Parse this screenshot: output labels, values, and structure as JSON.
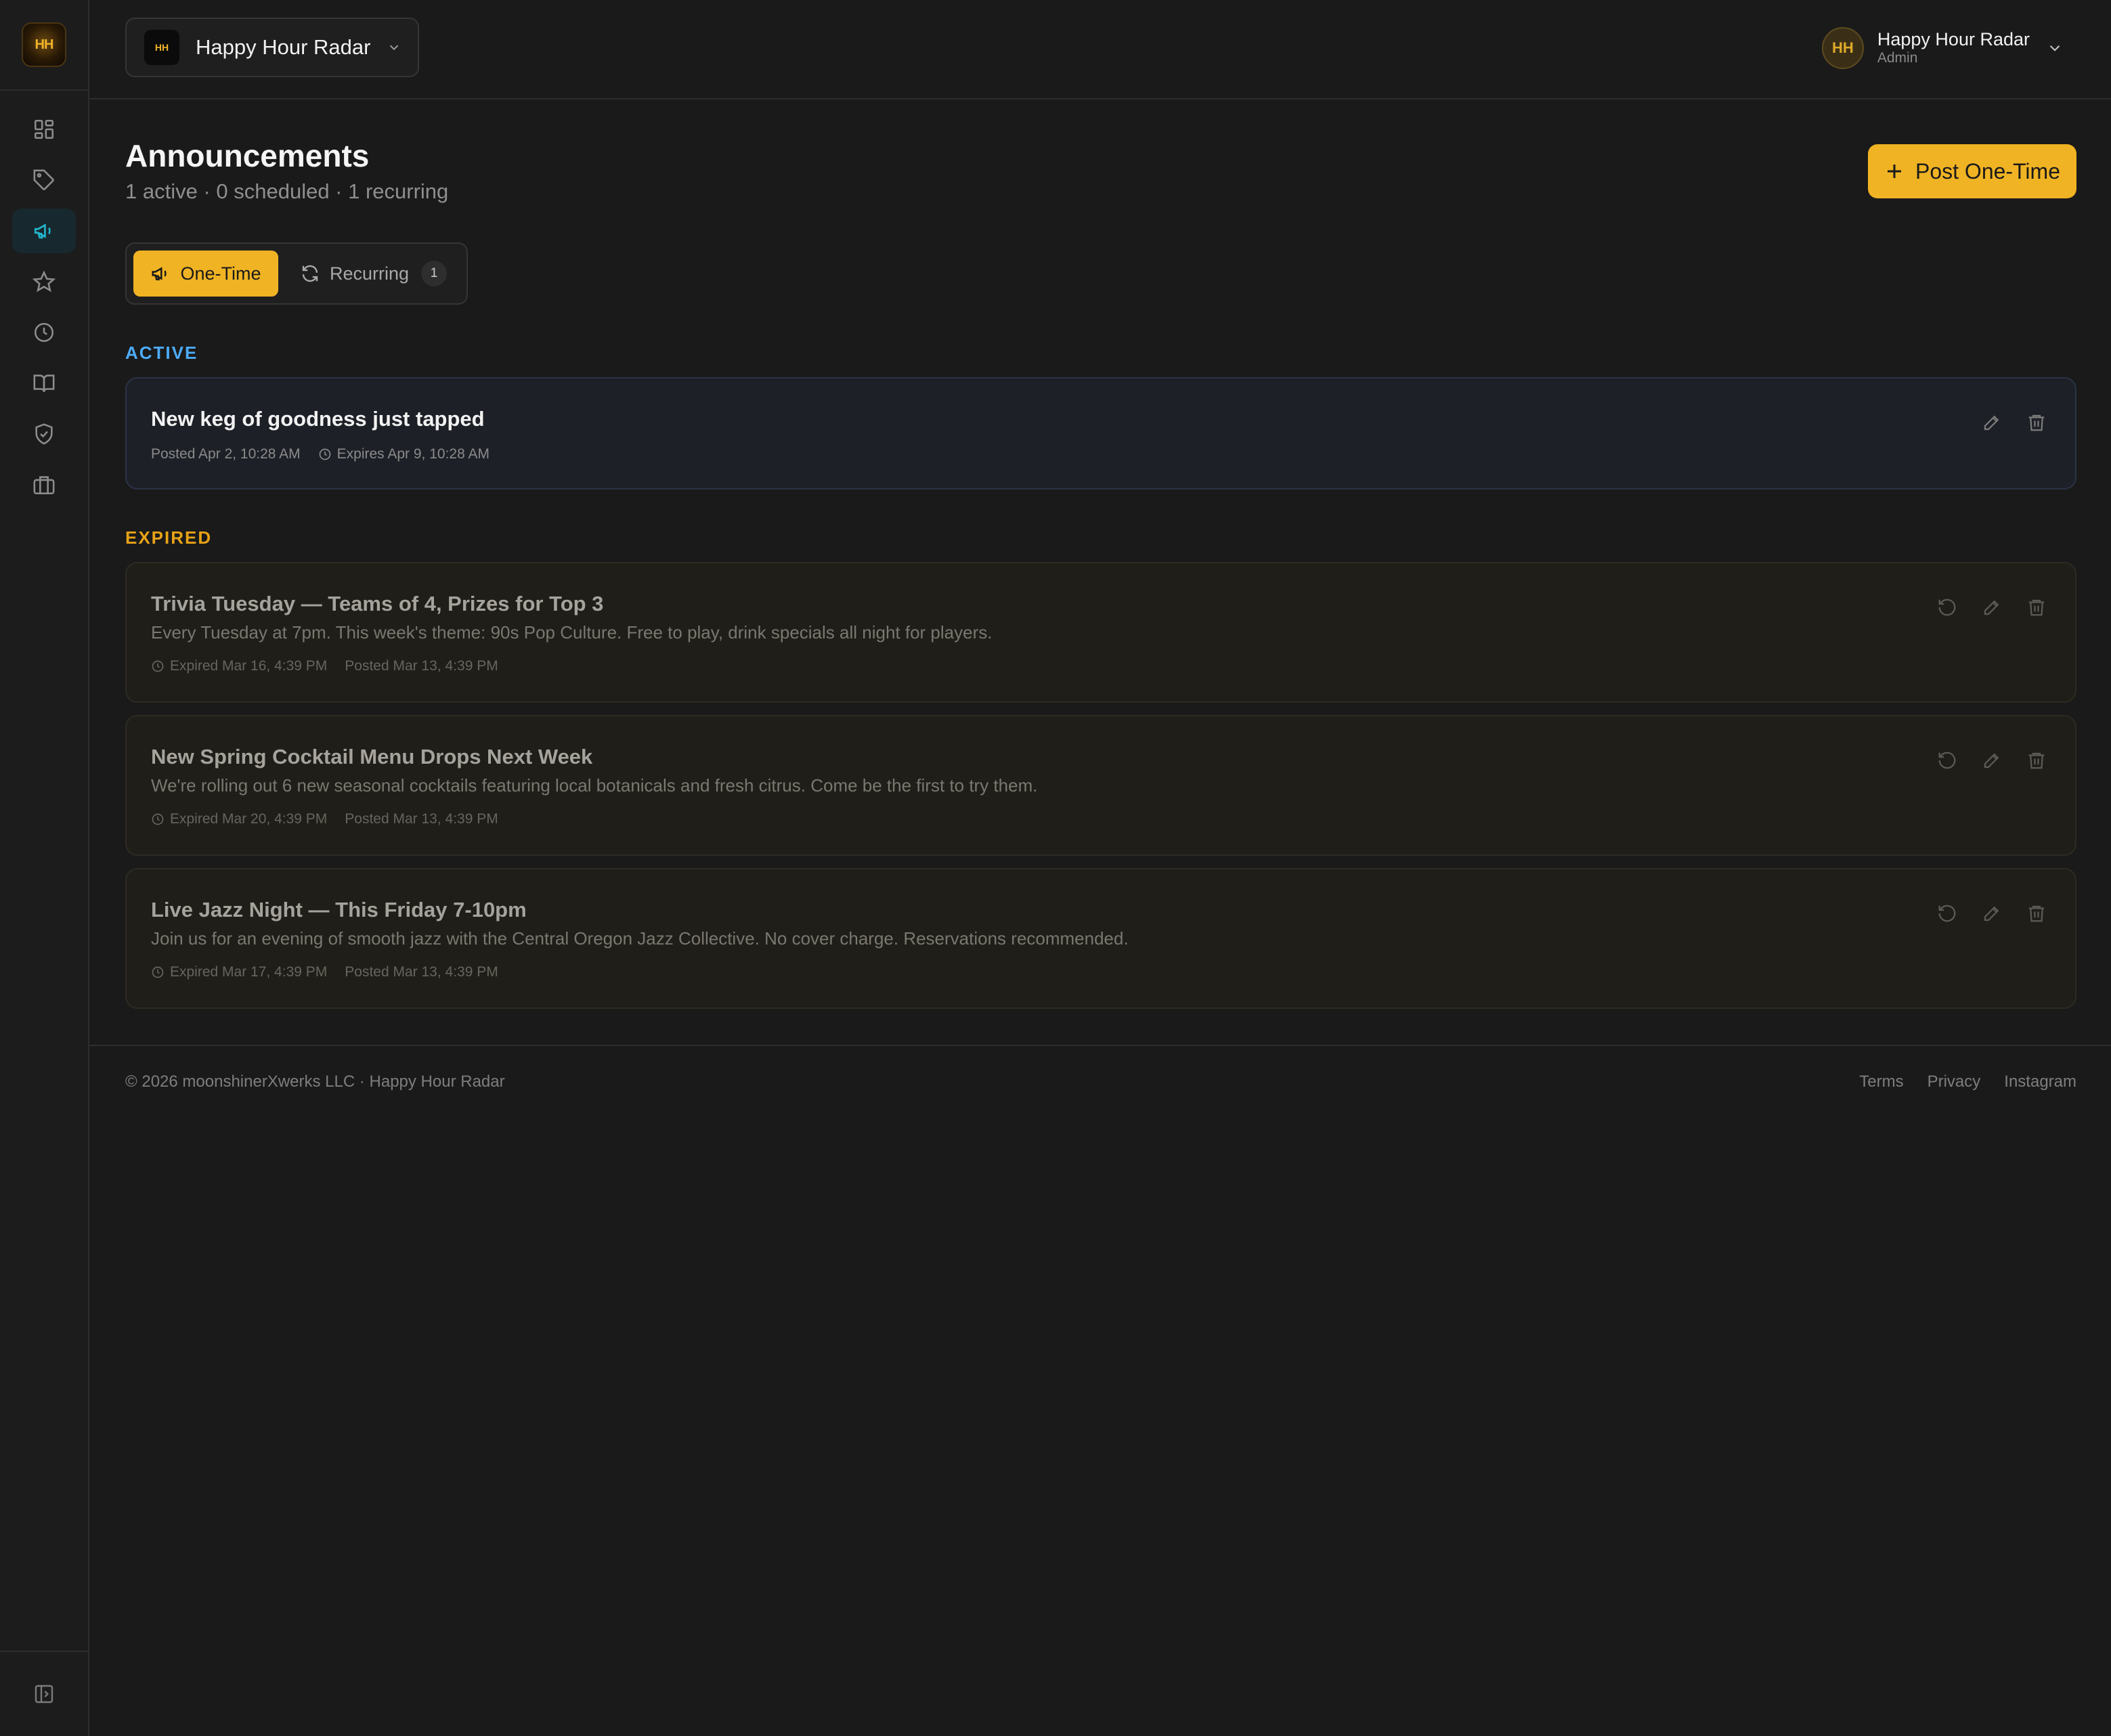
{
  "colors": {
    "accent": "#f0b323",
    "active_blue": "#4dabf7",
    "expired_amber": "#e8a317",
    "nav_active": "#22b8cf"
  },
  "sidebar": {
    "logo_text": "HH",
    "items": [
      {
        "icon": "dashboard-icon"
      },
      {
        "icon": "tag-icon"
      },
      {
        "icon": "megaphone-icon",
        "active": true
      },
      {
        "icon": "star-icon"
      },
      {
        "icon": "clock-icon"
      },
      {
        "icon": "book-icon"
      },
      {
        "icon": "shield-check-icon"
      },
      {
        "icon": "briefcase-icon"
      }
    ],
    "collapse_icon": "sidebar-collapse-icon"
  },
  "topbar": {
    "venue_logo_text": "HH",
    "venue_name": "Happy Hour Radar",
    "user": {
      "initials": "HH",
      "name": "Happy Hour Radar",
      "role": "Admin"
    }
  },
  "page": {
    "title": "Announcements",
    "subtitle": "1 active · 0 scheduled · 1 recurring",
    "post_button": "Post One-Time"
  },
  "tabs": {
    "one_time": "One-Time",
    "recurring": "Recurring",
    "recurring_count": "1"
  },
  "active_section": {
    "label": "ACTIVE",
    "items": [
      {
        "title": "New keg of goodness just tapped",
        "posted": "Posted Apr 2, 10:28 AM",
        "expires": "Expires Apr 9, 10:28 AM"
      }
    ]
  },
  "expired_section": {
    "label": "EXPIRED",
    "items": [
      {
        "title": "Trivia Tuesday — Teams of 4, Prizes for Top 3",
        "description": "Every Tuesday at 7pm. This week's theme: 90s Pop Culture. Free to play, drink specials all night for players.",
        "expired": "Expired Mar 16, 4:39 PM",
        "posted": "Posted Mar 13, 4:39 PM"
      },
      {
        "title": "New Spring Cocktail Menu Drops Next Week",
        "description": "We're rolling out 6 new seasonal cocktails featuring local botanicals and fresh citrus. Come be the first to try them.",
        "expired": "Expired Mar 20, 4:39 PM",
        "posted": "Posted Mar 13, 4:39 PM"
      },
      {
        "title": "Live Jazz Night — This Friday 7-10pm",
        "description": "Join us for an evening of smooth jazz with the Central Oregon Jazz Collective. No cover charge. Reservations recommended.",
        "expired": "Expired Mar 17, 4:39 PM",
        "posted": "Posted Mar 13, 4:39 PM"
      }
    ]
  },
  "footer": {
    "copyright": "© 2026 moonshinerXwerks LLC · Happy Hour Radar",
    "links": [
      "Terms",
      "Privacy",
      "Instagram"
    ]
  }
}
